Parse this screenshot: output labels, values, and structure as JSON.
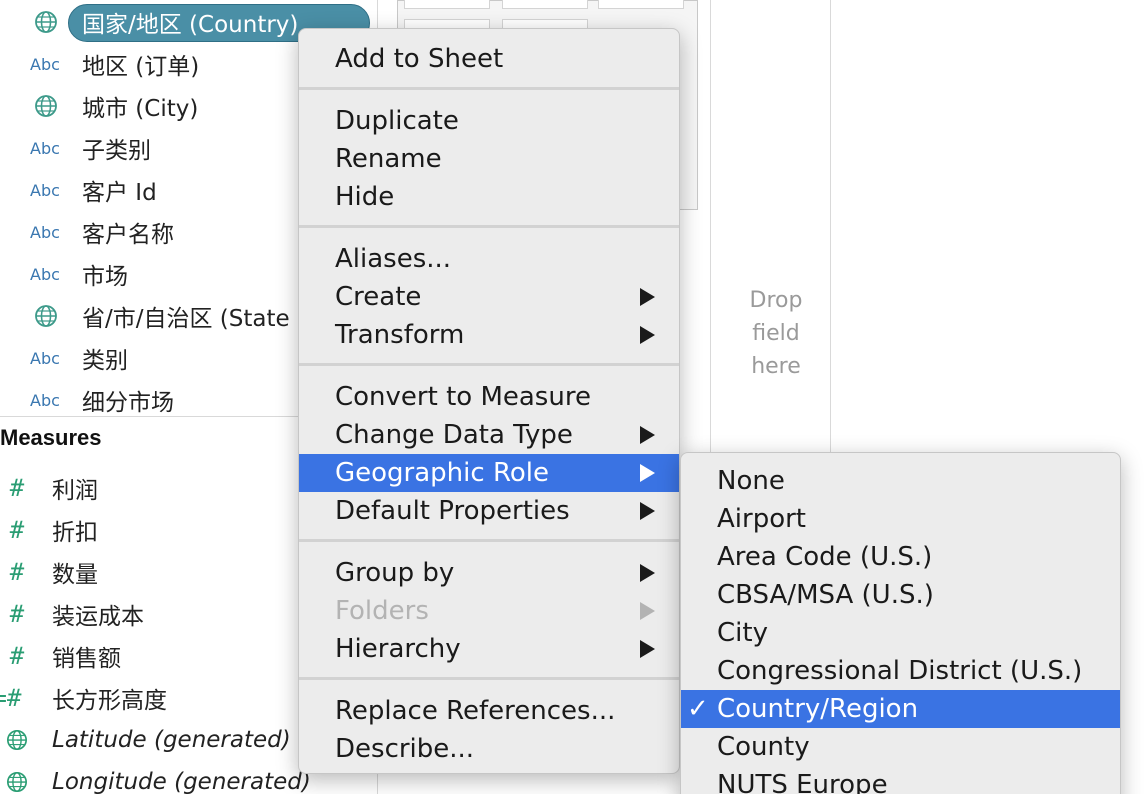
{
  "dimensions": [
    {
      "type": "globe",
      "label": "国家/地区 (Country)",
      "selected": true
    },
    {
      "type": "Abc",
      "label": "地区 (订单)"
    },
    {
      "type": "globe",
      "label": "城市 (City)"
    },
    {
      "type": "Abc",
      "label": "子类别"
    },
    {
      "type": "Abc",
      "label": "客户 Id"
    },
    {
      "type": "Abc",
      "label": "客户名称"
    },
    {
      "type": "Abc",
      "label": "市场"
    },
    {
      "type": "globe",
      "label": "省/市/自治区 (State"
    },
    {
      "type": "Abc",
      "label": "类别"
    },
    {
      "type": "Abc",
      "label": "细分市场"
    }
  ],
  "measures_title": "Measures",
  "measures": [
    {
      "type": "#",
      "label": "利润"
    },
    {
      "type": "#",
      "label": "折扣"
    },
    {
      "type": "#",
      "label": "数量"
    },
    {
      "type": "#",
      "label": "装运成本"
    },
    {
      "type": "#",
      "label": "销售额"
    },
    {
      "type": "=#",
      "label": "长方形高度"
    },
    {
      "type": "globe",
      "label": "Latitude (generated)",
      "italic": true
    },
    {
      "type": "globe",
      "label": "Longitude (generated)",
      "italic": true
    }
  ],
  "drop_zone": {
    "line1": "Drop",
    "line2": "field",
    "line3": "here"
  },
  "context_menu": {
    "add_to_sheet": "Add to Sheet",
    "duplicate": "Duplicate",
    "rename": "Rename",
    "hide": "Hide",
    "aliases": "Aliases...",
    "create": "Create",
    "transform": "Transform",
    "convert_to_measure": "Convert to Measure",
    "change_data_type": "Change Data Type",
    "geographic_role": "Geographic Role",
    "default_properties": "Default Properties",
    "group_by": "Group by",
    "folders": "Folders",
    "hierarchy": "Hierarchy",
    "replace_references": "Replace References...",
    "describe": "Describe..."
  },
  "geographic_role_submenu": {
    "checkmark": "✓",
    "items": [
      "None",
      "Airport",
      "Area Code (U.S.)",
      "CBSA/MSA (U.S.)",
      "City",
      "Congressional District (U.S.)",
      "Country/Region",
      "County",
      "NUTS Europe"
    ],
    "selected": "Country/Region"
  },
  "colors": {
    "menu_highlight": "#3a73e3",
    "selected_pill": "#4a8fa6",
    "abc_type": "#3a77b0",
    "measure_hash": "#2a9d73"
  }
}
